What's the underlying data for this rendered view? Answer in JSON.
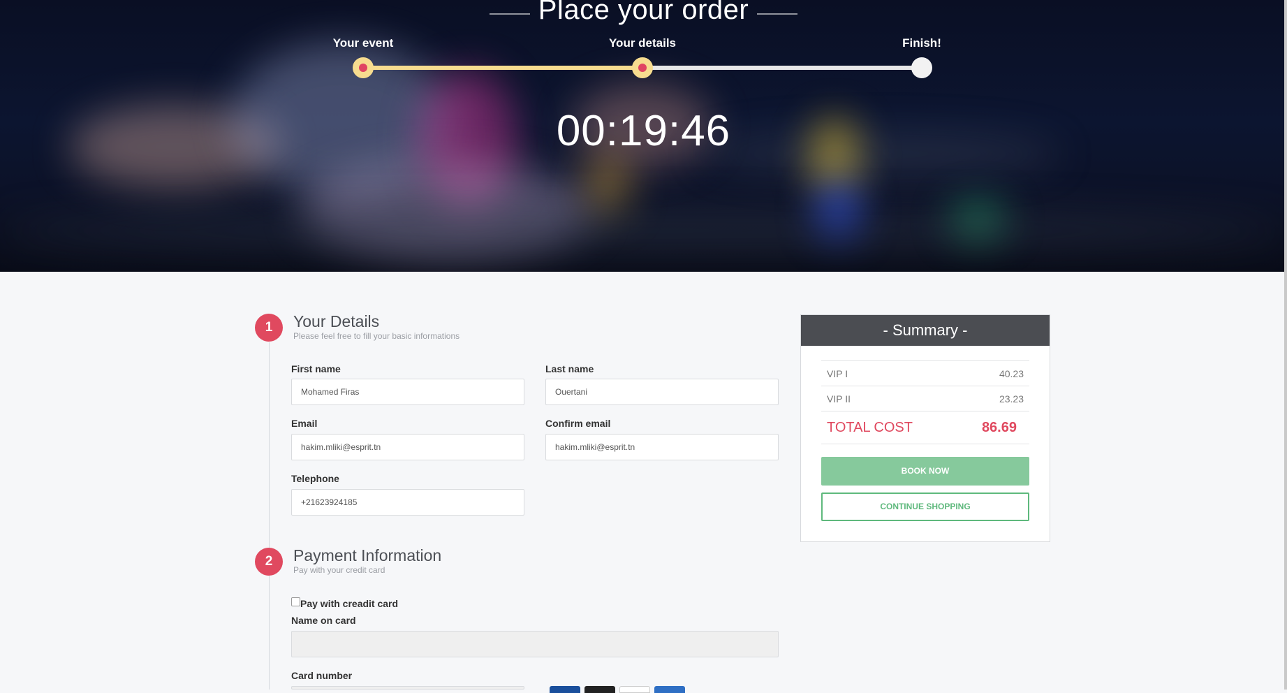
{
  "hero": {
    "title": "Place your order",
    "steps": [
      {
        "label": "Your event",
        "state": "done"
      },
      {
        "label": "Your details",
        "state": "done"
      },
      {
        "label": "Finish!",
        "state": "todo"
      }
    ],
    "timer": "00:19:46"
  },
  "details": {
    "number": "1",
    "title": "Your Details",
    "subtitle": "Please feel free to fill your basic informations",
    "first_name_label": "First name",
    "first_name_value": "Mohamed Firas",
    "last_name_label": "Last name",
    "last_name_value": "Ouertani",
    "email_label": "Email",
    "email_value": "hakim.mliki@esprit.tn",
    "confirm_email_label": "Confirm email",
    "confirm_email_value": "hakim.mliki@esprit.tn",
    "telephone_label": "Telephone",
    "telephone_value": "+21623924185"
  },
  "payment": {
    "number": "2",
    "title": "Payment Information",
    "subtitle": "Pay with your credit card",
    "checkbox_label": "Pay with creadit card",
    "name_on_card_label": "Name on card",
    "card_number_label": "Card number"
  },
  "summary": {
    "title": "- Summary -",
    "items": [
      {
        "name": "VIP I",
        "price": "40.23"
      },
      {
        "name": "VIP II",
        "price": "23.23"
      }
    ],
    "total_label": "TOTAL COST",
    "total_value": "86.69",
    "book_label": "BOOK NOW",
    "continue_label": "CONTINUE SHOPPING"
  },
  "colors": {
    "accent": "#e0495f",
    "progress": "#f7dc8f",
    "green": "#86c99c",
    "summary_header": "#4b4d52"
  },
  "icons": [
    "visa-icon",
    "mastercard-icon",
    "generic-card-icon",
    "amex-icon"
  ]
}
